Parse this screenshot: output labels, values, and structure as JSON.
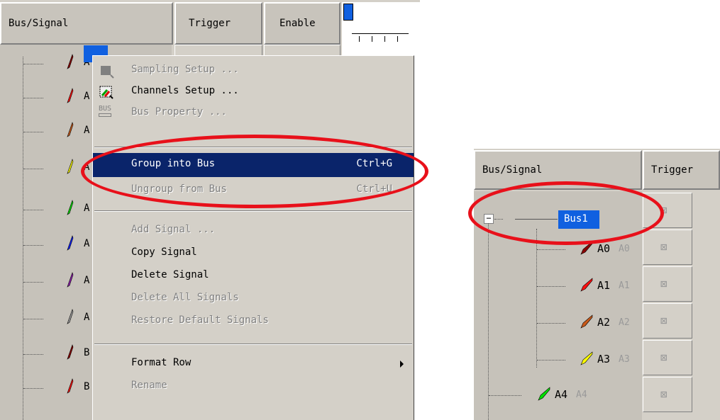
{
  "left_panel": {
    "headers": {
      "bus_signal": "Bus/Signal",
      "trigger": "Trigger",
      "enable": "Enable"
    },
    "rows": [
      {
        "color": "#8b0000",
        "letter": "A"
      },
      {
        "color": "#ff1010",
        "letter": "A"
      },
      {
        "color": "#c85a1a",
        "letter": "A"
      },
      {
        "color": "#ffff00",
        "letter": "A"
      },
      {
        "color": "#00e000",
        "letter": "A"
      },
      {
        "color": "#1020ff",
        "letter": "A"
      },
      {
        "color": "#9020b0",
        "letter": "A"
      },
      {
        "color": "#a0a0a0",
        "letter": "A"
      },
      {
        "color": "#8b0000",
        "letter": "B"
      },
      {
        "color": "#ff1010",
        "letter": "B"
      }
    ]
  },
  "context_menu": {
    "items": [
      {
        "label": "Sampling Setup ...",
        "shortcut": "",
        "enabled": false,
        "icon": "sampling-setup-icon"
      },
      {
        "label": "Channels Setup ...",
        "shortcut": "",
        "enabled": true,
        "icon": "channels-setup-icon"
      },
      {
        "label": "Bus Property ...",
        "shortcut": "",
        "enabled": false,
        "icon": "bus-property-icon"
      },
      {
        "label": "Group into Bus",
        "shortcut": "Ctrl+G",
        "enabled": true,
        "highlighted": true
      },
      {
        "label": "Ungroup from Bus",
        "shortcut": "Ctrl+U",
        "enabled": false
      },
      {
        "label": "Add Signal ...",
        "shortcut": "",
        "enabled": false
      },
      {
        "label": "Copy Signal",
        "shortcut": "",
        "enabled": true
      },
      {
        "label": "Delete Signal",
        "shortcut": "",
        "enabled": true
      },
      {
        "label": "Delete All Signals",
        "shortcut": "",
        "enabled": false
      },
      {
        "label": "Restore Default Signals",
        "shortcut": "",
        "enabled": false
      },
      {
        "label": "Format Row",
        "shortcut": "",
        "enabled": true,
        "submenu": true
      },
      {
        "label": "Rename",
        "shortcut": "",
        "enabled": false
      }
    ],
    "bus_icon_text": "BUS"
  },
  "right_panel": {
    "headers": {
      "bus_signal": "Bus/Signal",
      "trigger": "Trigger"
    },
    "bus": {
      "name": "Bus1",
      "expander": "−"
    },
    "signals": [
      {
        "name": "A0",
        "alias": "A0",
        "color": "#8b0000"
      },
      {
        "name": "A1",
        "alias": "A1",
        "color": "#ff1010"
      },
      {
        "name": "A2",
        "alias": "A2",
        "color": "#c85a1a"
      },
      {
        "name": "A3",
        "alias": "A3",
        "color": "#ffff00"
      },
      {
        "name": "A4",
        "alias": "A4",
        "color": "#00e000"
      }
    ],
    "trigger_symbol": "⊠"
  },
  "annotation_color": "#e8101a"
}
